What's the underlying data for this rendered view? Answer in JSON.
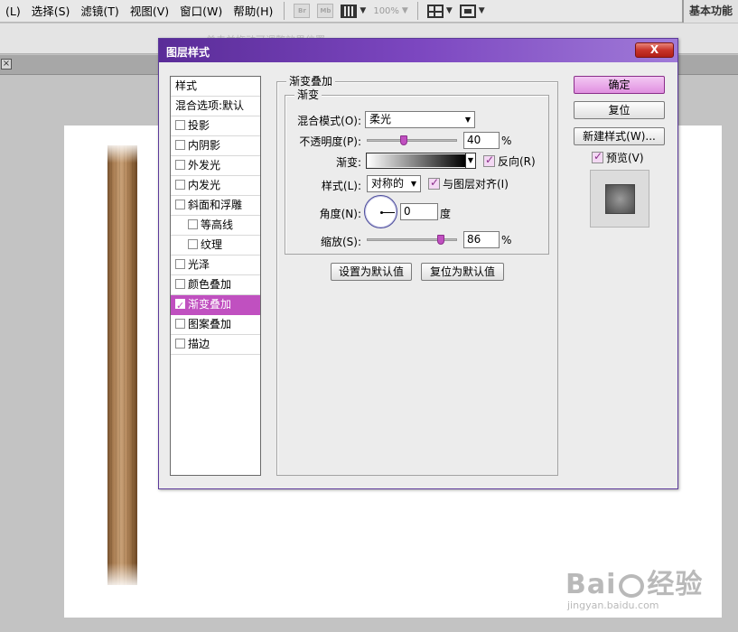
{
  "menubar": {
    "items": [
      "(L)",
      "选择(S)",
      "滤镜(T)",
      "视图(V)",
      "窗口(W)",
      "帮助(H)"
    ],
    "toolbar": {
      "br": "Br",
      "mb": "Mb",
      "zoom": "100%"
    },
    "workspace": "基本功能"
  },
  "optionsbar": {
    "hint": "单击并拖动可调整效果位置"
  },
  "document": {
    "close": "×"
  },
  "dialog": {
    "title": "图层样式",
    "close_label": "X",
    "style_list": [
      {
        "label": "样式",
        "checkbox": false,
        "checked": false,
        "sub": false,
        "selected": false
      },
      {
        "label": "混合选项:默认",
        "checkbox": false,
        "checked": false,
        "sub": false,
        "selected": false
      },
      {
        "label": "投影",
        "checkbox": true,
        "checked": false,
        "sub": false,
        "selected": false
      },
      {
        "label": "内阴影",
        "checkbox": true,
        "checked": false,
        "sub": false,
        "selected": false
      },
      {
        "label": "外发光",
        "checkbox": true,
        "checked": false,
        "sub": false,
        "selected": false
      },
      {
        "label": "内发光",
        "checkbox": true,
        "checked": false,
        "sub": false,
        "selected": false
      },
      {
        "label": "斜面和浮雕",
        "checkbox": true,
        "checked": false,
        "sub": false,
        "selected": false
      },
      {
        "label": "等高线",
        "checkbox": true,
        "checked": false,
        "sub": true,
        "selected": false
      },
      {
        "label": "纹理",
        "checkbox": true,
        "checked": false,
        "sub": true,
        "selected": false
      },
      {
        "label": "光泽",
        "checkbox": true,
        "checked": false,
        "sub": false,
        "selected": false
      },
      {
        "label": "颜色叠加",
        "checkbox": true,
        "checked": false,
        "sub": false,
        "selected": false
      },
      {
        "label": "渐变叠加",
        "checkbox": true,
        "checked": true,
        "sub": false,
        "selected": true
      },
      {
        "label": "图案叠加",
        "checkbox": true,
        "checked": false,
        "sub": false,
        "selected": false
      },
      {
        "label": "描边",
        "checkbox": true,
        "checked": false,
        "sub": false,
        "selected": false
      }
    ],
    "panel": {
      "outer_legend": "渐变叠加",
      "inner_legend": "渐变",
      "blend_mode_label": "混合模式(O):",
      "blend_mode_value": "柔光",
      "opacity_label": "不透明度(P):",
      "opacity_value": "40",
      "opacity_fraction": 0.4,
      "percent": "%",
      "gradient_label": "渐变:",
      "reverse_label": "反向(R)",
      "reverse_checked": true,
      "style_label": "样式(L):",
      "style_value": "对称的",
      "align_label": "与图层对齐(I)",
      "align_checked": true,
      "angle_label": "角度(N):",
      "angle_value": "0",
      "degree": "度",
      "scale_label": "缩放(S):",
      "scale_value": "86",
      "scale_fraction": 0.86,
      "set_default": "设置为默认值",
      "reset_default": "复位为默认值"
    },
    "buttons": {
      "ok": "确定",
      "reset": "复位",
      "new_style": "新建样式(W)...",
      "preview_label": "预览(V)",
      "preview_checked": true
    }
  },
  "watermark": {
    "logo": "Bai",
    "logo_tail": "经验",
    "url": "jingyan.baidu.com"
  },
  "colors": {
    "accent": "#c050c0",
    "title_bar": "#6a38b0",
    "close": "#c8342a"
  }
}
